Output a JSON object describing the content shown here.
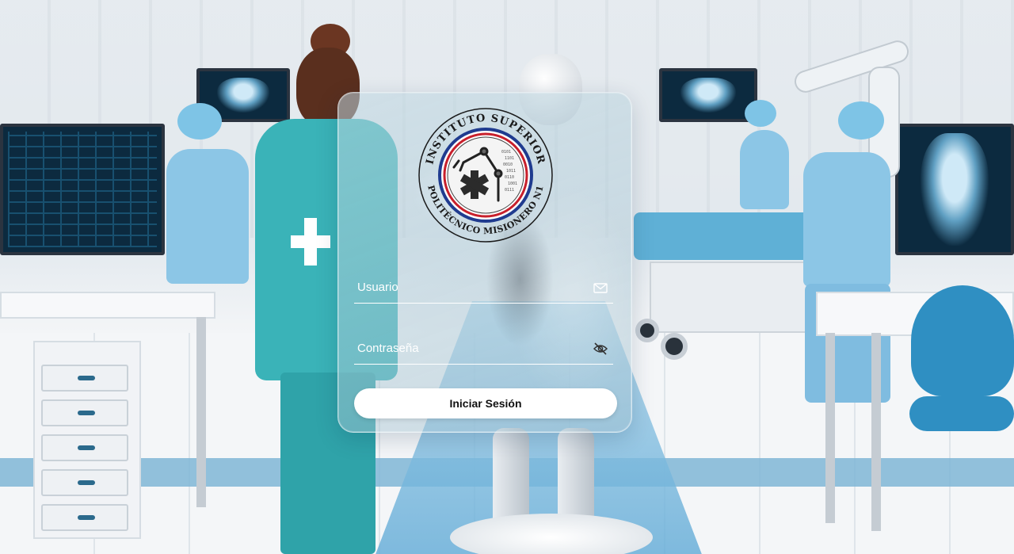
{
  "login": {
    "logo_top_text": "INSTITUTO SUPERIOR",
    "logo_bottom_text": "POLITÉCNICO MISIONERO N1",
    "username_placeholder": "Usuario",
    "password_placeholder": "Contraseña",
    "submit_label": "Iniciar Sesión",
    "icons": {
      "username": "mail-icon",
      "password": "eye-slash-icon"
    }
  },
  "colors": {
    "card_border": "#ffffff",
    "button_bg": "#ffffff",
    "logo_ring_blue": "#1f3b8f",
    "logo_ring_red": "#c8202c"
  }
}
